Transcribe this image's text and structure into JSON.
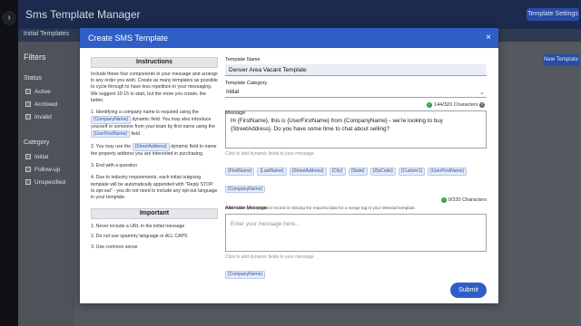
{
  "app": {
    "title": "Sms Template Manager",
    "settings_button": "Template Settings",
    "tab": "Initial Templates",
    "new_template_button": "New Template",
    "rail_toggle": "›"
  },
  "filters": {
    "heading": "Filters",
    "status_label": "Status",
    "status_options": [
      "Active",
      "Archived",
      "Invalid"
    ],
    "category_label": "Category",
    "category_options": [
      "Initial",
      "Follow-up",
      "Unspecified"
    ]
  },
  "modal": {
    "title": "Create SMS Template",
    "close_glyph": "×",
    "instructions": {
      "title": "Instructions",
      "intro": "Include these four components in your message and arrange in any order you wish. Create as many templates as possible to cycle through to have less repetition in your messaging. We suggest 10-15 to start, but the more you create, the better.",
      "step1_a": "1. Identifying a company name is required using the",
      "step1_tag1": "{CompanyName}",
      "step1_b": "dynamic field. You may also introduce yourself or someone from your team by first name using the",
      "step1_tag2": "{UserFirstName}",
      "step1_c": "field.",
      "step2_a": "2. You may use the",
      "step2_tag": "{StreetAddress}",
      "step2_b": "dynamic field to name the property address you are interested in purchasing.",
      "step3": "3. End with a question",
      "step4": "4. Due to industry requirements, each initial outgoing template will be automatically appended with \"Reply STOP to opt-out\" - you do not need to include any opt-out language in your template."
    },
    "important": {
      "title": "Important",
      "items": [
        "1. Never include a URL in the initial message",
        "2. Do not use spammy language or ALL CAPS",
        "3. Use common sense"
      ]
    },
    "form": {
      "name_label": "Template Name",
      "name_value": "Denver Area Vacant Template",
      "category_label": "Template Category",
      "category_value": "Initial",
      "category_chevron": "⌄",
      "message_label": "Message",
      "message_count": "144/320 Characters",
      "message_value": "Hi {FirstName}, this is {UserFirstName} from {CompanyName} - we're looking to buy {StreetAddress}. Do you have some time to chat about selling?",
      "dynamic_hint": "Click to add dynamic fields to your message.",
      "dynamic_tags": [
        "{FirstName}",
        "{LastName}",
        "{StreetAddress}",
        "{City}",
        "{State}",
        "{ZipCode}",
        "{Custom1}",
        "{UserFirstName}",
        "{CompanyName}"
      ],
      "alt_label": "Alternate Message",
      "alt_count": "0/320 Characters",
      "alt_subhint": "Used when your prospect record is missing the required data for a merge tag in your selected template.",
      "alt_placeholder": "Enter your message here...",
      "alt_hint": "Click to add dynamic fields to your message.",
      "alt_tags": [
        "{CompanyName}"
      ],
      "check_glyph": "✓",
      "info_glyph": "?"
    },
    "submit_label": "Submit"
  },
  "colors": {
    "accent": "#2f5fc6",
    "success": "#2c9a4a",
    "topbar": "#1c2b4d"
  }
}
